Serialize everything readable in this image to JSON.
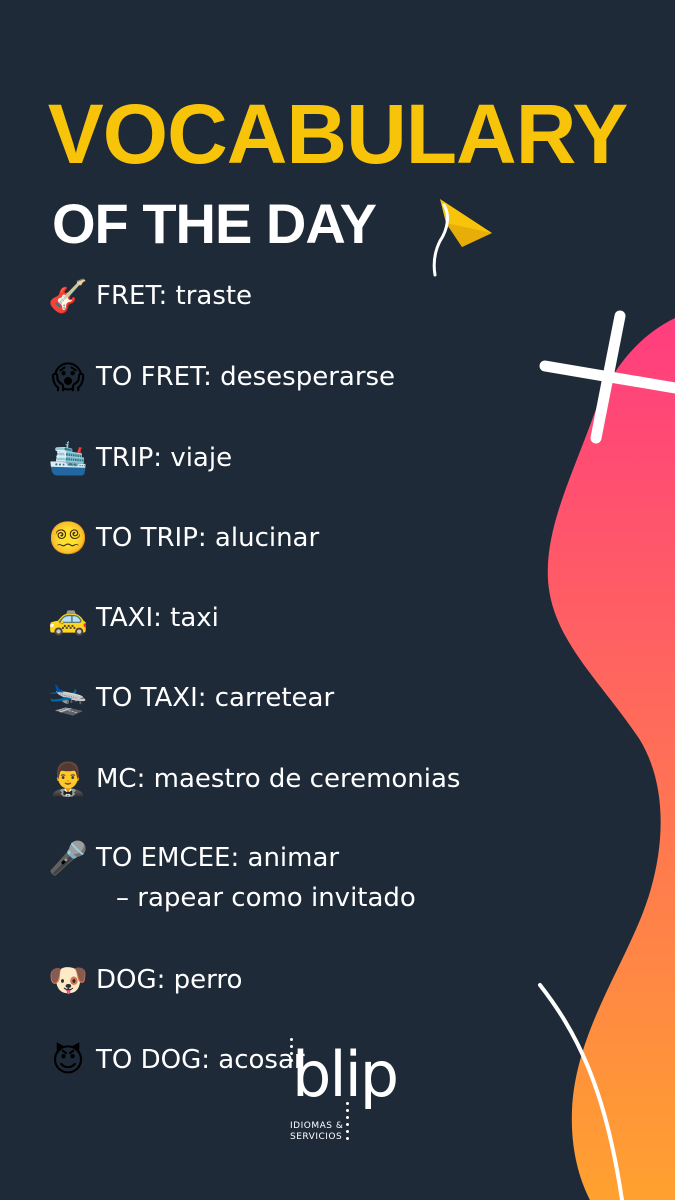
{
  "header": {
    "title_line1": "VOCABULARY",
    "title_line2": "OF THE DAY"
  },
  "colors": {
    "background": "#1e2a38",
    "title_accent": "#f8c40a",
    "blob_top": "#ff3d7f",
    "blob_bottom": "#ffa12f",
    "text": "#ffffff"
  },
  "items": [
    {
      "icon": "guitar-icon",
      "emoji": "🎸",
      "text": "FRET: traste"
    },
    {
      "icon": "screaming-face-icon",
      "emoji": "😱",
      "text": "TO FRET: desesperarse"
    },
    {
      "icon": "ship-icon",
      "emoji": "🛳️",
      "text": "TRIP: viaje"
    },
    {
      "icon": "dizzy-face-icon",
      "emoji": "😵‍💫",
      "text": "TO TRIP: alucinar"
    },
    {
      "icon": "taxi-icon",
      "emoji": "🚕",
      "text": "TAXI: taxi"
    },
    {
      "icon": "airplane-icon",
      "emoji": "🛬",
      "text": "TO TAXI: carretear"
    },
    {
      "icon": "man-in-tuxedo-icon",
      "emoji": "🤵‍♂️",
      "text": "MC: maestro de ceremonias"
    },
    {
      "icon": "microphone-icon",
      "emoji": "🎤",
      "text": "TO EMCEE: animar",
      "text2": "– rapear como invitado"
    },
    {
      "icon": "dog-face-icon",
      "emoji": "🐶",
      "text": "DOG: perro"
    },
    {
      "icon": "devil-face-icon",
      "emoji": "😈",
      "text": "TO DOG: acosar"
    }
  ],
  "logo": {
    "word": "blip",
    "line1": "IDIOMAS &",
    "line2": "SERVICIOS"
  }
}
